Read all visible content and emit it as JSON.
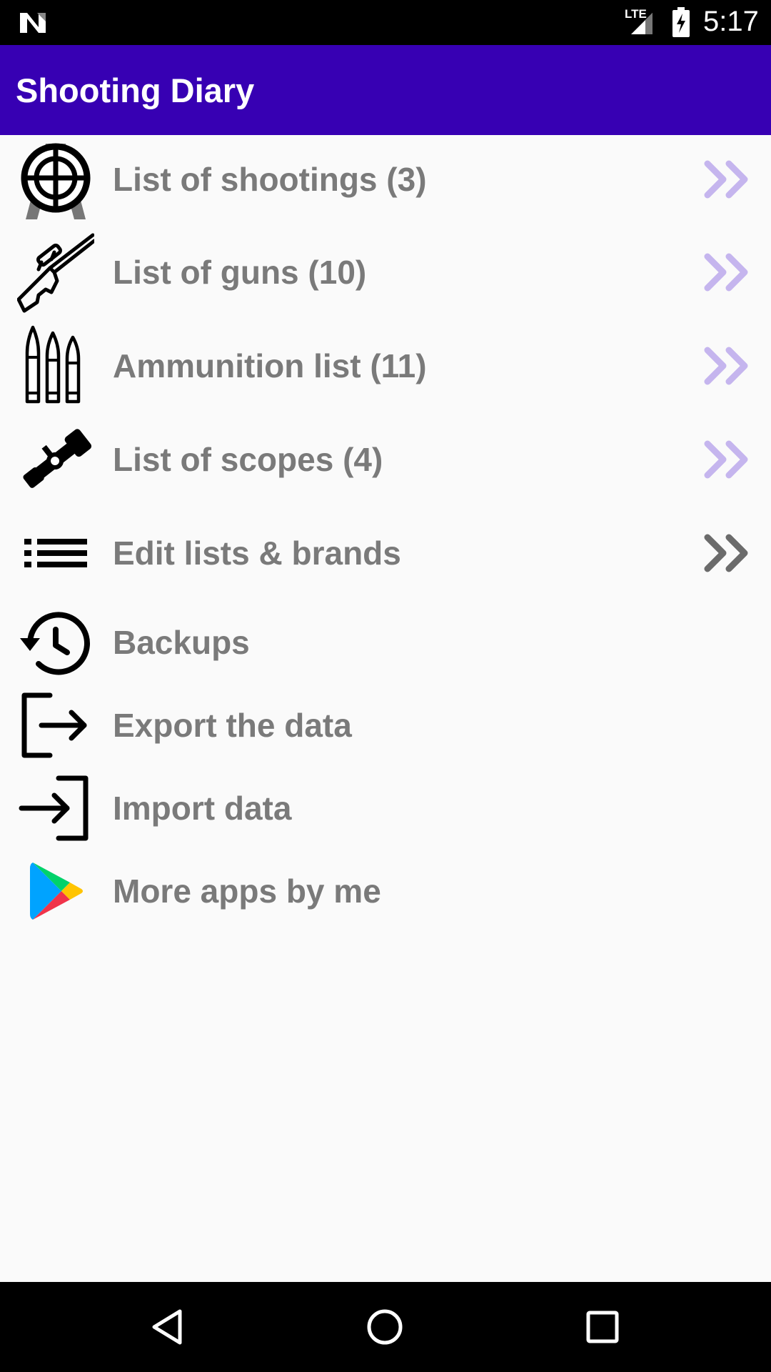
{
  "status_bar": {
    "network": "LTE",
    "time": "5:17",
    "icons": [
      "n-notification-icon",
      "signal-icon",
      "battery-charging-icon"
    ]
  },
  "app_bar": {
    "title": "Shooting Diary"
  },
  "menu": {
    "items": [
      {
        "label": "List of shootings (3)",
        "icon": "target-tripod-icon",
        "chevron": "light"
      },
      {
        "label": "List of guns (10)",
        "icon": "rifle-icon",
        "chevron": "light"
      },
      {
        "label": "Ammunition list (11)",
        "icon": "bullets-icon",
        "chevron": "light"
      },
      {
        "label": "List of scopes (4)",
        "icon": "scope-icon",
        "chevron": "light"
      },
      {
        "label": "Edit lists & brands",
        "icon": "list-icon",
        "chevron": "dark"
      },
      {
        "label": "Backups",
        "icon": "history-icon"
      },
      {
        "label": "Export the data",
        "icon": "export-icon"
      },
      {
        "label": "Import data",
        "icon": "import-icon"
      },
      {
        "label": "More apps by me",
        "icon": "play-store-icon"
      }
    ]
  },
  "colors": {
    "app_bar": "#3700b3",
    "label_text": "#7a7a7a",
    "chevron_light": "#c5b5ee",
    "chevron_dark": "#6b6b6b"
  },
  "nav_bar": {
    "icons": [
      "back-icon",
      "home-icon",
      "recents-icon"
    ]
  }
}
